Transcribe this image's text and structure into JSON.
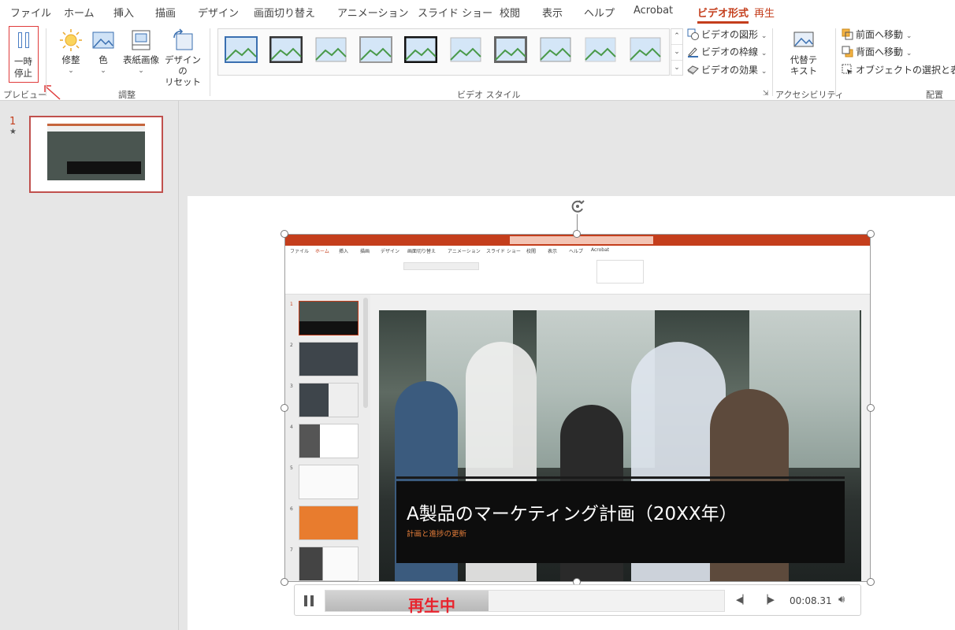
{
  "tabs": [
    {
      "label": "ファイル"
    },
    {
      "label": "ホーム"
    },
    {
      "label": "挿入"
    },
    {
      "label": "描画"
    },
    {
      "label": "デザイン"
    },
    {
      "label": "画面切り替え"
    },
    {
      "label": "アニメーション"
    },
    {
      "label": "スライド ショー"
    },
    {
      "label": "校閲"
    },
    {
      "label": "表示"
    },
    {
      "label": "ヘルプ"
    },
    {
      "label": "Acrobat"
    },
    {
      "label": "ビデオ形式"
    },
    {
      "label": "再生"
    }
  ],
  "ribbon": {
    "preview": {
      "pause_line1": "一時",
      "pause_line2": "停止",
      "group": "プレビュー"
    },
    "adjust": {
      "corrections": "修整",
      "color": "色",
      "poster_frame": "表紙画像",
      "reset_line1": "デザインの",
      "reset_line2": "リセット",
      "group": "調整"
    },
    "video_styles": {
      "shape": "ビデオの図形",
      "border": "ビデオの枠線",
      "effects": "ビデオの効果",
      "group": "ビデオ スタイル"
    },
    "accessibility": {
      "alt_line1": "代替テ",
      "alt_line2": "キスト",
      "group": "アクセシビリティ"
    },
    "arrange": {
      "bring_forward": "前面へ移動",
      "send_backward": "背面へ移動",
      "selection_pane": "オブジェクトの選択と表示",
      "group": "配置"
    }
  },
  "slides": {
    "current_number": "1",
    "star": "★"
  },
  "video": {
    "title": "A製品のマーケティング計画（20XX年）",
    "subtitle": "計画と進捗の更新",
    "inner_tabs": [
      "ファイル",
      "ホーム",
      "挿入",
      "描画",
      "デザイン",
      "画面切り替え",
      "アニメーション",
      "スライド ショー",
      "校閲",
      "表示",
      "ヘルプ",
      "Acrobat"
    ],
    "inner_thumb_numbers": [
      "1",
      "2",
      "3",
      "4",
      "5",
      "6",
      "7"
    ]
  },
  "player": {
    "status_label": "再生中",
    "time": "00:08.31",
    "progress": 0.41
  },
  "colors": {
    "accent": "#c43e1c",
    "playing_label": "#e8242e"
  }
}
